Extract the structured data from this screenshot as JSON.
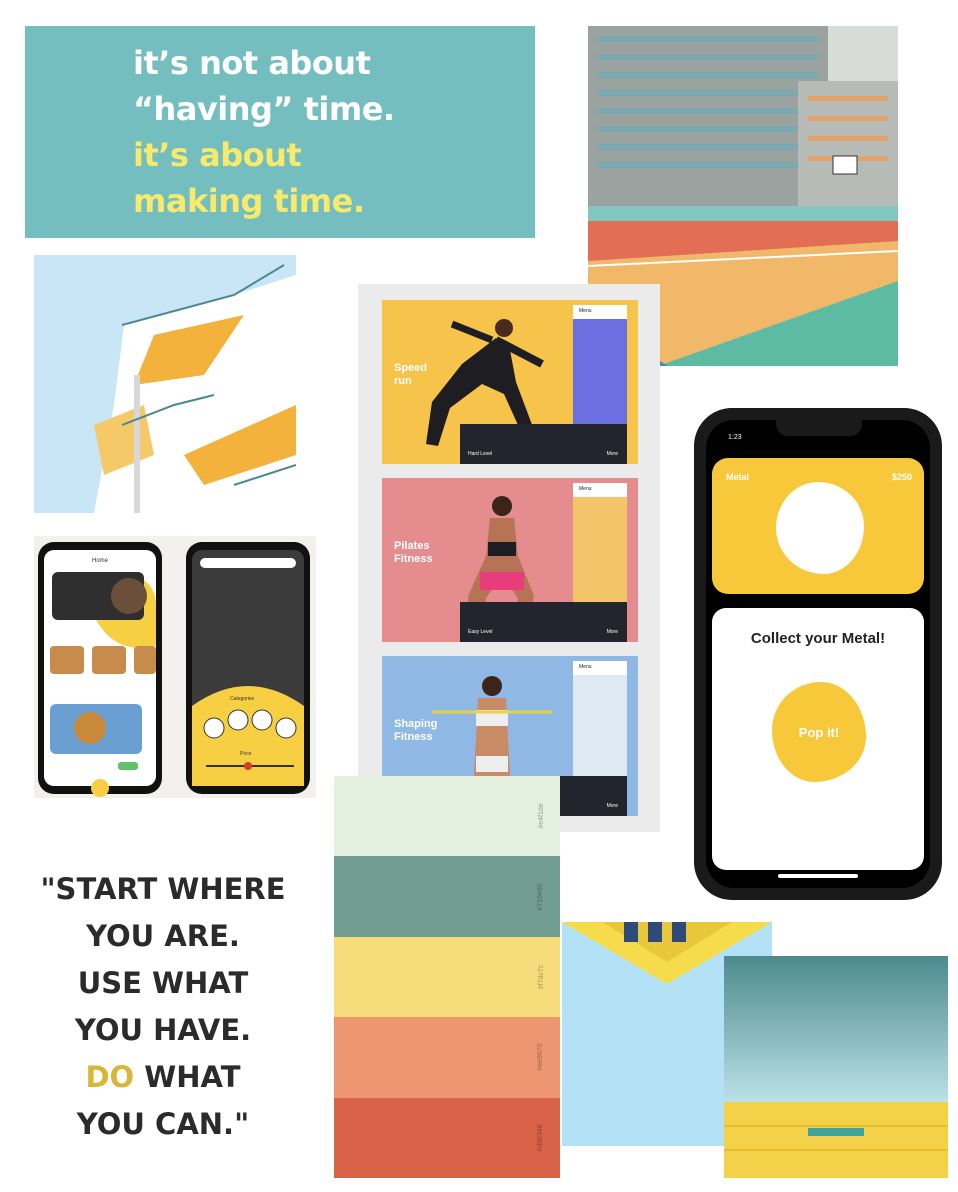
{
  "quote_top": {
    "line1": "it’s not about",
    "line2": "“having” time.",
    "line3": "it’s about",
    "line4": "making time."
  },
  "fitness_cards": [
    {
      "title1": "Speed",
      "title2": "run",
      "level": "Hard Level",
      "more": "More",
      "menu": "Menu"
    },
    {
      "title1": "Pilates",
      "title2": "Fitness",
      "level": "Easy Level",
      "more": "More",
      "menu": "Menu"
    },
    {
      "title1": "Shaping",
      "title2": "Fitness",
      "level": "",
      "more": "More",
      "menu": "Menu"
    }
  ],
  "phone_app": {
    "status_time": "1:23",
    "card_title": "Metal",
    "card_price": "$250",
    "collect_text": "Collect your Metal!",
    "pop_button": "Pop it!"
  },
  "food_app": {
    "home_title": "Home",
    "categories_title": "Categories",
    "price_label": "Price"
  },
  "quote_bottom": {
    "line1": "\"START WHERE",
    "line2": "YOU ARE.",
    "line3": "USE WHAT",
    "line4": "YOU HAVE.",
    "line5a": "DO",
    "line5b": " WHAT",
    "line6": "YOU CAN.\""
  },
  "palette": [
    {
      "hex": "#e4f1de",
      "code": "#e4f1de"
    },
    {
      "hex": "#719e90",
      "code": "#719e90"
    },
    {
      "hex": "#f7dc7c",
      "code": "#f7dc7c"
    },
    {
      "hex": "#ee9670",
      "code": "#ee9670"
    },
    {
      "hex": "#d96348",
      "code": "#d96348"
    }
  ],
  "colors": {
    "teal": "#74bec0",
    "accent_yellow": "#f7ea6d",
    "metal_yellow": "#f7c839"
  }
}
